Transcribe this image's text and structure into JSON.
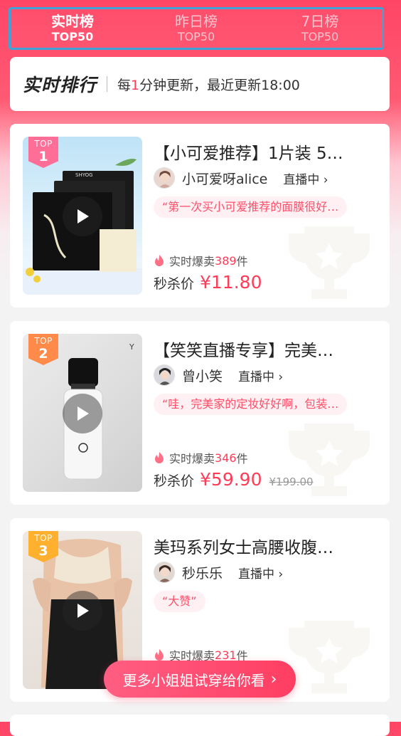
{
  "tabs": [
    {
      "label": "实时榜",
      "sub": "TOP50"
    },
    {
      "label": "昨日榜",
      "sub": "TOP50"
    },
    {
      "label": "7日榜",
      "sub": "TOP50"
    }
  ],
  "info": {
    "title": "实时排行",
    "text_prefix": "每",
    "text_num": "1",
    "text_suffix": "分钟更新，最近更新18:00"
  },
  "products": [
    {
      "rank_top": "TOP",
      "rank_num": "1",
      "title": "【小可爱推荐】1片装 5…",
      "host": "小可爱呀alice",
      "live": "直播中",
      "comment": "“第一次买小可爱推荐的面膜很好…",
      "sales_prefix": "实时爆卖",
      "sales_count": "389",
      "sales_unit": "件",
      "price_label": "秒杀价",
      "price": "¥11.80",
      "original_price": "",
      "rank_color": "#ff6e97"
    },
    {
      "rank_top": "TOP",
      "rank_num": "2",
      "title": "【笑笑直播专享】完美…",
      "host": "曾小笑",
      "live": "直播中",
      "comment": "“哇，完美家的定妆好好啊，包装…",
      "sales_prefix": "实时爆卖",
      "sales_count": "346",
      "sales_unit": "件",
      "price_label": "秒杀价",
      "price": "¥59.90",
      "original_price": "¥199.00",
      "rank_color": "#ff8a4a"
    },
    {
      "rank_top": "TOP",
      "rank_num": "3",
      "title": "美玛系列女士高腰收腹…",
      "host": "秒乐乐",
      "live": "直播中",
      "comment": "“大赞”",
      "sales_prefix": "实时爆卖",
      "sales_count": "231",
      "sales_unit": "件",
      "price_label": "",
      "price": "",
      "original_price": "",
      "rank_color": "#ffb02e"
    }
  ],
  "more_button": "更多小姐姐试穿给你看",
  "colors": {
    "accent": "#ff3b57",
    "tab_border": "#3da4d9"
  }
}
